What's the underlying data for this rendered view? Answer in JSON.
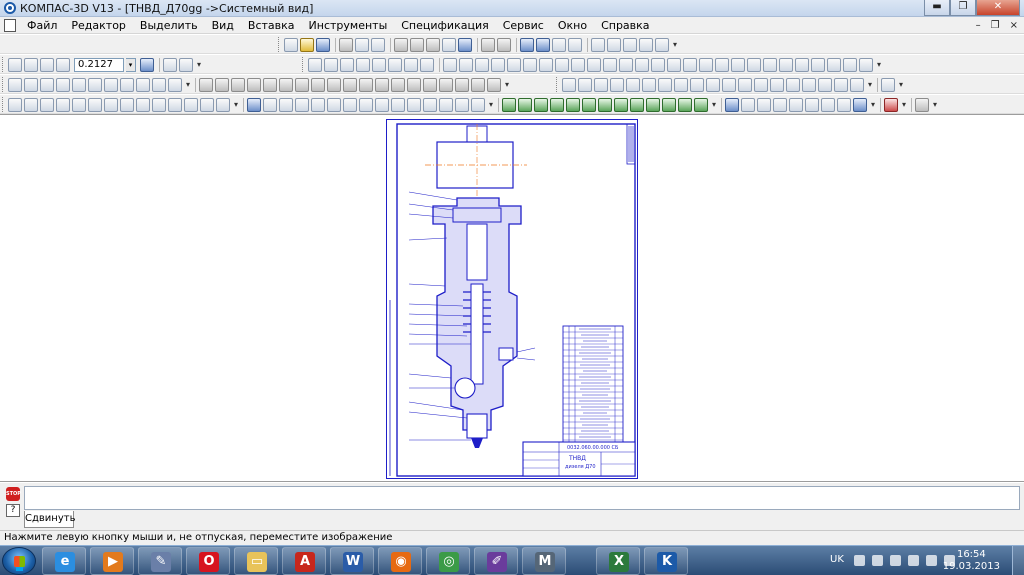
{
  "window": {
    "title": "КОМПАС-3D V13 - [ТНВД_Д70gg ->Системный вид]",
    "minimize": "▬",
    "restore": "❐",
    "close": "✕"
  },
  "menu": {
    "items": [
      "Файл",
      "Редактор",
      "Выделить",
      "Вид",
      "Вставка",
      "Инструменты",
      "Спецификация",
      "Сервис",
      "Окно",
      "Справка"
    ],
    "mdi_minimize": "–",
    "mdi_restore": "❐",
    "mdi_close": "×"
  },
  "toolbar": {
    "zoom_value": "0.2127",
    "zoom_dropdown": "▾",
    "more": "▾"
  },
  "sheet": {
    "title_block_name": "ТНВД",
    "title_block_subtitle": "дизеля Д70",
    "title_block_code": "0032.060.00.000 СБ",
    "parts_list_rows": 20,
    "border_color": "#1e1ec8",
    "axis_color": "#f07820"
  },
  "command_panel": {
    "stop_icon": "STOP",
    "help_icon": "?",
    "tab_label": "Сдвинуть"
  },
  "status": {
    "hint": "Нажмите левую кнопку мыши и, не отпуская, переместите изображение"
  },
  "taskbar": {
    "apps": [
      {
        "name": "explorer",
        "glyph": "e",
        "color": "#2b8ee0"
      },
      {
        "name": "media-player",
        "glyph": "▶",
        "color": "#e27a1d"
      },
      {
        "name": "paint-tool",
        "glyph": "✎",
        "color": "#6a7fa8"
      },
      {
        "name": "opera",
        "glyph": "O",
        "color": "#d7141f"
      },
      {
        "name": "folder",
        "glyph": "▭",
        "color": "#e8c35a"
      },
      {
        "name": "acrobat",
        "glyph": "A",
        "color": "#c7271c"
      },
      {
        "name": "word",
        "glyph": "W",
        "color": "#2a5ca8"
      },
      {
        "name": "firefox",
        "glyph": "◉",
        "color": "#e66a12"
      },
      {
        "name": "chrome",
        "glyph": "◎",
        "color": "#3b9b47"
      },
      {
        "name": "pencil-app",
        "glyph": "✐",
        "color": "#6a3c9c"
      },
      {
        "name": "m-app",
        "glyph": "M",
        "color": "#556677"
      },
      {
        "name": "excel",
        "glyph": "X",
        "color": "#2c7a3c"
      },
      {
        "name": "kompas",
        "glyph": "K",
        "color": "#1c5aa8"
      }
    ],
    "language": "UK",
    "time": "16:54",
    "date": "19.03.2013"
  }
}
